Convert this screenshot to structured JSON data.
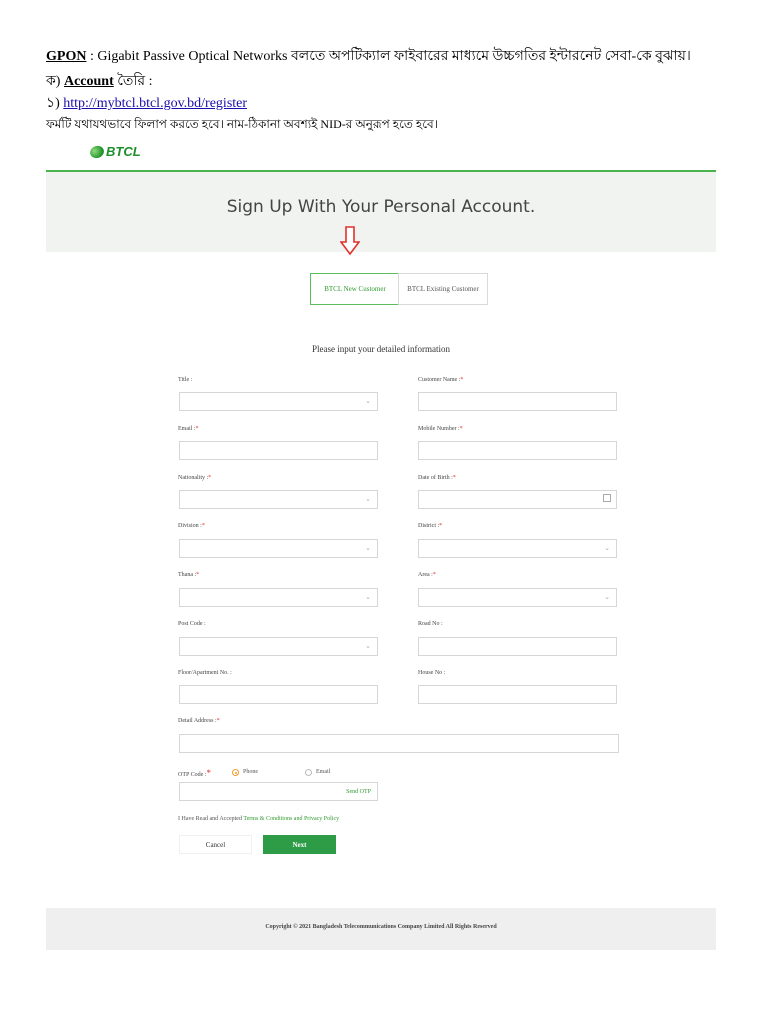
{
  "doc": {
    "line1_term": "GPON",
    "line1_rest": " : Gigabit Passive Optical Networks বলতে অপটিক্যাল ফাইবারের মাধ্যমে উচ্চগতির ইন্টারনেট সেবা-কে বুঝায়।",
    "line2_prefix": "ক) ",
    "line2_term": "Account",
    "line2_rest": " তৈরি :",
    "line3_prefix": "১) ",
    "line3_link": "http://mybtcl.btcl.gov.bd/register",
    "line4": "ফর্মটি যথাযথভাবে ফিলাপ করতে হবে। নাম-ঠিকানা অবশ্যই NID-র অনুরূপ হতে হবে।"
  },
  "logo": {
    "text": "BTCL"
  },
  "form": {
    "title": "Sign Up With Your Personal Account.",
    "tabs": {
      "new": "BTCL New Customer",
      "existing": "BTCL Existing Customer"
    },
    "subheading": "Please input your detailed information",
    "required_mark": "*",
    "fields": {
      "title": "Title :",
      "customer_name": "Customer Name :",
      "email": "Email :",
      "mobile": "Mobile Number :",
      "nationality": "Nationality :",
      "dob": "Date of Birth :",
      "division": "Division :",
      "district": "District :",
      "thana": "Thana :",
      "area": "Area :",
      "post_code": "Post Code :",
      "road_no": "Road No :",
      "floor": "Floor/Apartment No. :",
      "house_no": "House No :",
      "detail_address": "Detail Address :",
      "otp_code": "OTP Code :"
    },
    "otp_options": {
      "phone": "Phone",
      "email": "Email"
    },
    "send_otp": "Send OTP",
    "terms_prefix": "I Have Read and Accepted ",
    "terms_link": "Terms & Conditions and Privacy Policy",
    "buttons": {
      "cancel": "Cancel",
      "next": "Next"
    },
    "footer": "Copyright © 2021 Bangladesh Telecommunications Company Limited All Rights Reserved"
  },
  "colors": {
    "brand_green": "#2e9b47",
    "required_red": "#e0322a",
    "radio_orange": "#f39b2e",
    "arrow_red": "#e0322a"
  }
}
